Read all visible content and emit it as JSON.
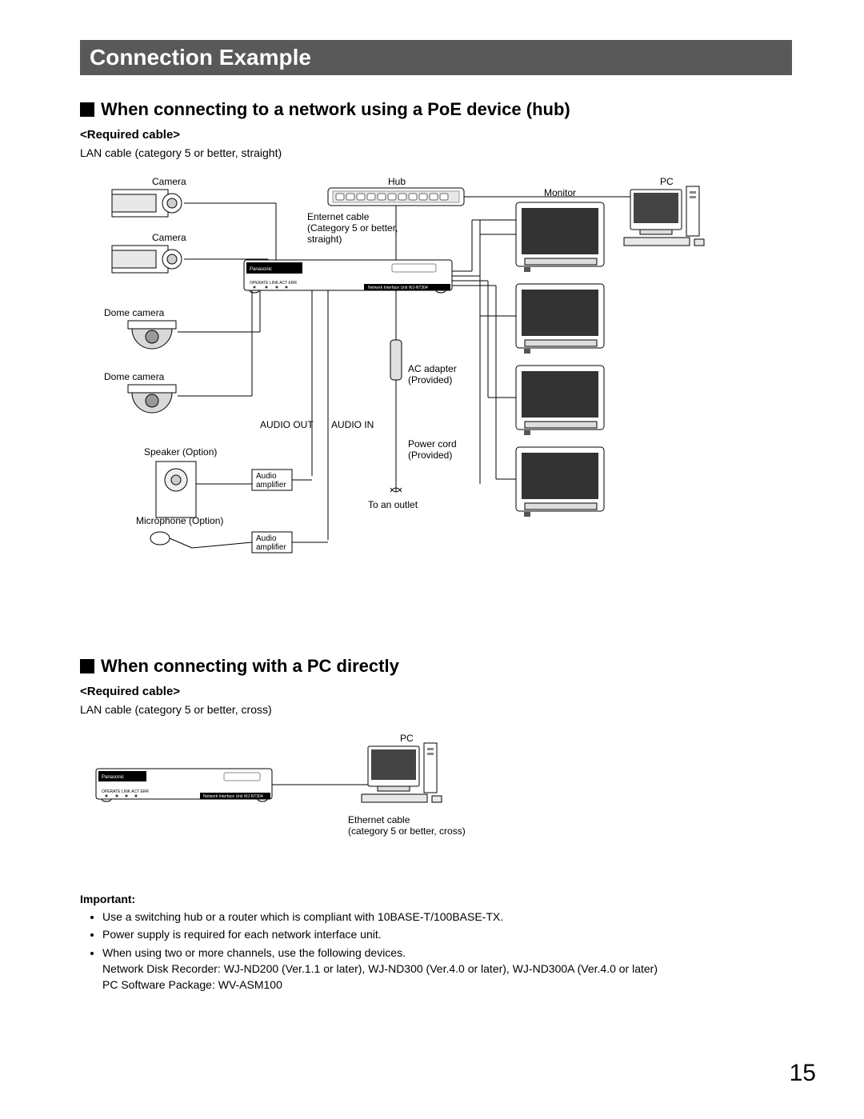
{
  "titleBar": "Connection Example",
  "section1": {
    "heading": "When connecting to a network using a PoE device (hub)",
    "subHeading": "<Required cable>",
    "body": "LAN cable (category 5 or better, straight)",
    "labels": {
      "camera1": "Camera",
      "camera2": "Camera",
      "domeCamera1": "Dome camera",
      "domeCamera2": "Dome camera",
      "hub": "Hub",
      "ethernetCable1": "Enternet cable",
      "ethernetCable2": "(Category 5 or better,",
      "ethernetCable3": "straight)",
      "audioOut": "AUDIO OUT",
      "audioIn": "AUDIO IN",
      "speaker": "Speaker (Option)",
      "microphone": "Microphone (Option)",
      "audioAmp": "Audio amplifier",
      "acAdapter1": "AC adapter",
      "acAdapter2": "(Provided)",
      "powerCord1": "Power cord",
      "powerCord2": "(Provided)",
      "toOutlet": "To an outlet",
      "monitor": "Monitor",
      "pc": "PC",
      "niuText": "Network Interface Unit WJ-NT304",
      "brand": "Panasonic",
      "leds": "OPERATE  LINK  ACT  ERR"
    }
  },
  "section2": {
    "heading": "When connecting with a PC directly",
    "subHeading": "<Required cable>",
    "body": "LAN cable (category 5 or better, cross)",
    "labels": {
      "pc": "PC",
      "ethernet1": "Ethernet cable",
      "ethernet2": "(category 5 or better, cross)",
      "niuText": "Network Interface Unit WJ-NT304",
      "brand": "Panasonic",
      "leds": "OPERATE  LINK  ACT  ERR"
    }
  },
  "important": {
    "title": "Important:",
    "bullets": [
      "Use a switching hub or a router which is compliant with 10BASE-T/100BASE-TX.",
      "Power supply is required for each network interface unit.",
      "When using two or more channels, use the following devices."
    ],
    "subLines": [
      "Network Disk Recorder: WJ-ND200 (Ver.1.1 or later), WJ-ND300 (Ver.4.0 or later), WJ-ND300A (Ver.4.0 or later)",
      "PC Software Package: WV-ASM100"
    ]
  },
  "pageNumber": "15"
}
